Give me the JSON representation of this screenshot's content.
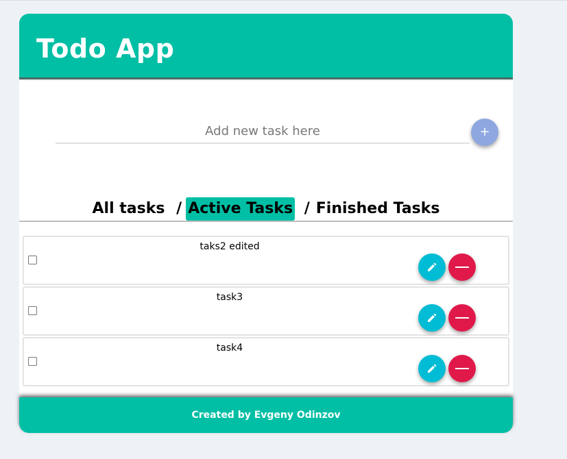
{
  "header": {
    "title": "Todo App"
  },
  "input": {
    "placeholder": "Add new task here",
    "add_label": "+"
  },
  "filters": {
    "items": [
      {
        "label": "All tasks",
        "active": false
      },
      {
        "label": "Active Tasks",
        "active": true
      },
      {
        "label": "Finished Tasks",
        "active": false
      }
    ],
    "separator": "/"
  },
  "tasks": [
    {
      "text": "taks2 edited",
      "checked": false
    },
    {
      "text": "task3",
      "checked": false
    },
    {
      "text": "task4",
      "checked": false
    }
  ],
  "icons": {
    "edit": "pencil-icon",
    "delete": "minus-icon",
    "add": "plus-icon"
  },
  "colors": {
    "accent": "#00bfa5",
    "add_button": "#8ea7e0",
    "edit_button": "#00bcd4",
    "delete_button": "#e0194a"
  },
  "footer": {
    "text": "Created by Evgeny Odinzov"
  }
}
